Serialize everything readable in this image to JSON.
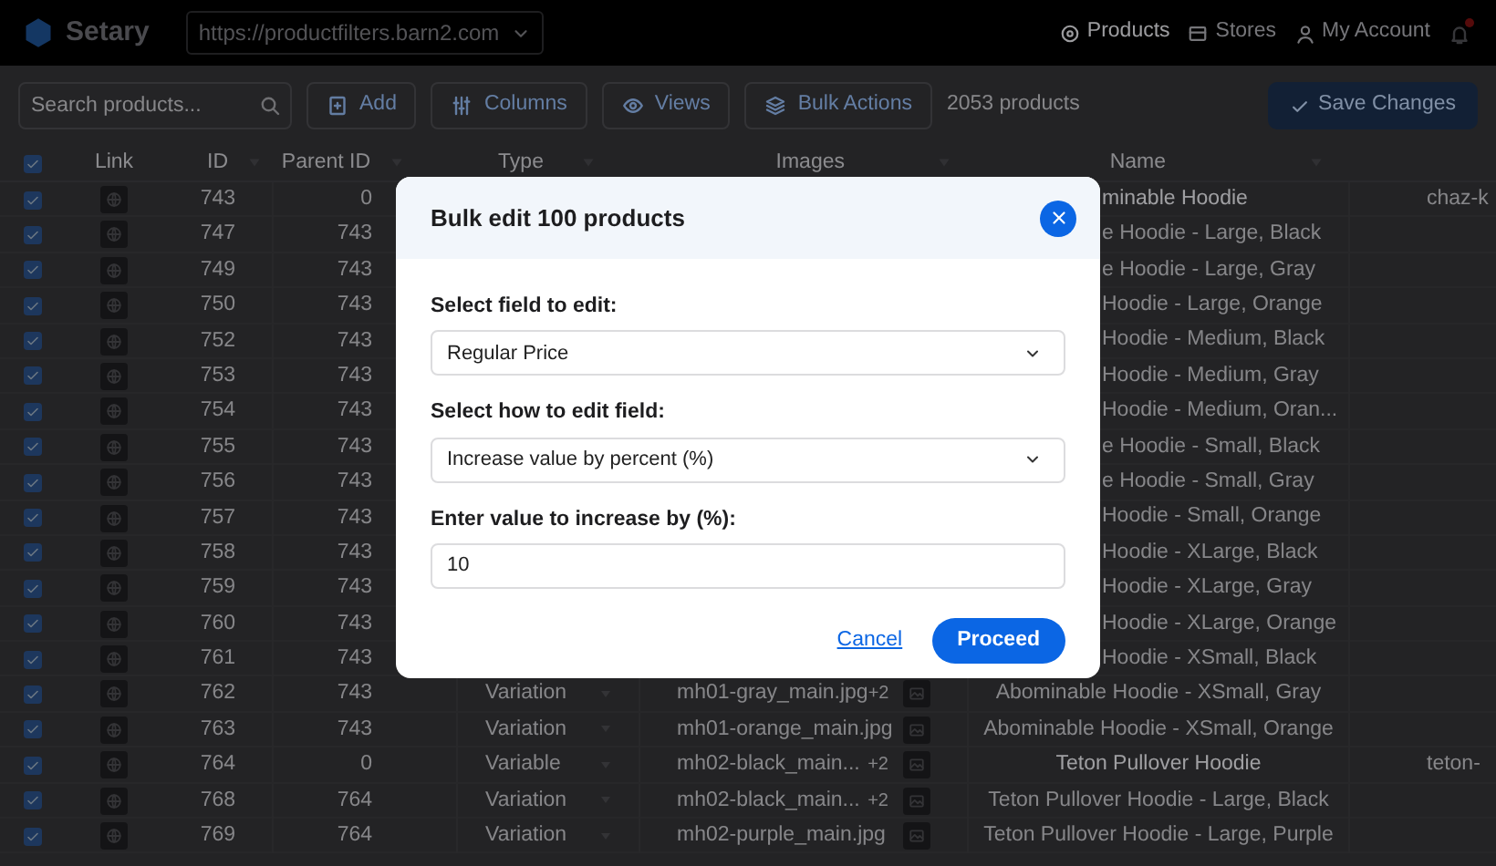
{
  "app": {
    "name": "Setary",
    "site": "https://productfilters.barn2.com",
    "nav": [
      {
        "label": "Products",
        "selected": true
      },
      {
        "label": "Stores",
        "selected": false
      },
      {
        "label": "My Account",
        "selected": false
      }
    ]
  },
  "toolbar": {
    "search_placeholder": "Search products...",
    "buttons": [
      "Add",
      "Columns",
      "Views",
      "Bulk Actions"
    ],
    "count": "2053 products",
    "save": "Save Changes"
  },
  "table": {
    "all_checked": true,
    "columns": [
      "Link",
      "ID",
      "Parent ID",
      "Type",
      "Images",
      "Name"
    ],
    "rows": [
      {
        "checked": true,
        "id": "743",
        "parent_id": "0",
        "name": "minable Hoodie",
        "slug": "chaz-k"
      },
      {
        "checked": true,
        "id": "747",
        "parent_id": "743",
        "name": "e Hoodie - Large, Black"
      },
      {
        "checked": true,
        "id": "749",
        "parent_id": "743",
        "name": "e Hoodie - Large, Gray"
      },
      {
        "checked": true,
        "id": "750",
        "parent_id": "743",
        "name": "Hoodie - Large, Orange"
      },
      {
        "checked": true,
        "id": "752",
        "parent_id": "743",
        "name": "Hoodie - Medium, Black"
      },
      {
        "checked": true,
        "id": "753",
        "parent_id": "743",
        "name": "Hoodie - Medium, Gray"
      },
      {
        "checked": true,
        "id": "754",
        "parent_id": "743",
        "name": "Hoodie - Medium, Oran..."
      },
      {
        "checked": true,
        "id": "755",
        "parent_id": "743",
        "name": "e Hoodie - Small, Black"
      },
      {
        "checked": true,
        "id": "756",
        "parent_id": "743",
        "name": "e Hoodie - Small, Gray"
      },
      {
        "checked": true,
        "id": "757",
        "parent_id": "743",
        "name": "Hoodie - Small, Orange"
      },
      {
        "checked": true,
        "id": "758",
        "parent_id": "743",
        "name": "Hoodie - XLarge, Black"
      },
      {
        "checked": true,
        "id": "759",
        "parent_id": "743",
        "name": "Hoodie - XLarge, Gray"
      },
      {
        "checked": true,
        "id": "760",
        "parent_id": "743",
        "name": "Hoodie - XLarge, Orange"
      },
      {
        "checked": true,
        "id": "761",
        "parent_id": "743",
        "name": "Hoodie - XSmall, Black"
      },
      {
        "checked": true,
        "id": "762",
        "parent_id": "743",
        "type": "Variation",
        "image": "mh01-gray_main.jpg",
        "extra_images": "+2",
        "name": "Abominable Hoodie - XSmall, Gray"
      },
      {
        "checked": true,
        "id": "763",
        "parent_id": "743",
        "type": "Variation",
        "image": "mh01-orange_main.jpg",
        "name": "Abominable Hoodie - XSmall, Orange"
      },
      {
        "checked": true,
        "id": "764",
        "parent_id": "0",
        "type": "Variable",
        "image": "mh02-black_main...",
        "extra_images": "+2",
        "name": "Teton Pullover Hoodie",
        "slug": "teton-"
      },
      {
        "checked": true,
        "id": "768",
        "parent_id": "764",
        "type": "Variation",
        "image": "mh02-black_main...",
        "extra_images": "+2",
        "name": "Teton Pullover Hoodie - Large, Black"
      },
      {
        "checked": true,
        "id": "769",
        "parent_id": "764",
        "type": "Variation",
        "image": "mh02-purple_main.jpg",
        "name": "Teton Pullover Hoodie - Large, Purple"
      }
    ]
  },
  "dialog": {
    "title": "Bulk edit 100 products",
    "fields": [
      {
        "kind": "select",
        "label": "Select field to edit:",
        "value": "Regular Price"
      },
      {
        "kind": "select",
        "label": "Select how to edit field:",
        "value": "Increase value by percent (%)"
      },
      {
        "kind": "input",
        "label": "Enter value to increase by (%):",
        "value": "10"
      }
    ],
    "cancel": "Cancel",
    "proceed": "Proceed"
  }
}
